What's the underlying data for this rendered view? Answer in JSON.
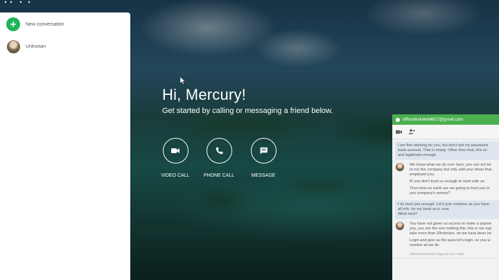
{
  "sidebar": {
    "new_conversation_label": "New conversation",
    "contact_label": "Unknown"
  },
  "hero": {
    "title": "Hi, Mercury!",
    "subtitle": "Get started by calling or messaging a friend below.",
    "actions": [
      {
        "label": "VIDEO CALL",
        "icon": "video-camera-icon"
      },
      {
        "label": "PHONE CALL",
        "icon": "phone-icon"
      },
      {
        "label": "MESSAGE",
        "icon": "message-icon"
      }
    ]
  },
  "chat": {
    "email": "officedeskweb4617@gmail.com",
    "messages": [
      {
        "dir": "out",
        "lines": [
          "I am fine working for you, but don't ask my password",
          "bank account. That is shady. Other than that, this so",
          "and legitimate enough."
        ]
      },
      {
        "dir": "in",
        "paras": [
          [
            "We know what we do over here, you can not tel",
            "to run the company but only add your ideas that",
            "employed you."
          ],
          [
            "IF you don't trust us enough to work with us."
          ],
          [
            "Then how on earth are we going to trust you to",
            "you company's money?"
          ]
        ]
      },
      {
        "dir": "out",
        "lines": [
          "I do trust you enough. Let's just continue as you have",
          "all info. for my bank acct. now",
          "What next?"
        ]
      },
      {
        "dir": "in",
        "paras": [
          [
            "You have not given us access to make a payme",
            "you, you are the one holding this, this is not sup",
            "take more than 20minutes. an we have been he"
          ],
          [
            "Login and give us the pass let's login, so you w",
            "monitor all we do."
          ]
        ]
      }
    ],
    "stamp": "officedeskweb4617@gmail.com • Now"
  },
  "colors": {
    "accent_green": "#1fb35a",
    "chat_header": "#4caf50",
    "outgoing_bubble": "#dde6ef"
  }
}
